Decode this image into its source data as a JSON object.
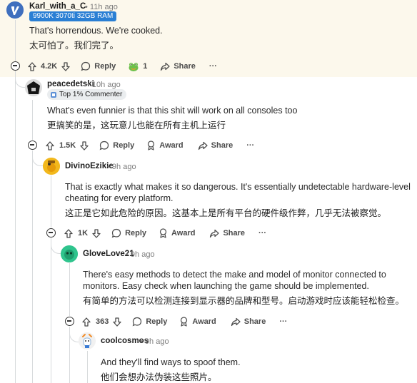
{
  "comments": [
    {
      "username": "Karl_with_a_C",
      "time": "11h ago",
      "flair": "9900K 3070ti 32GB RAM",
      "text": "That's horrendous. We're cooked.",
      "translation": "太可怕了。我们完了。",
      "votes": "4.2K",
      "reply_label": "Reply",
      "award_count": "1",
      "share_label": "Share",
      "more_label": "···"
    },
    {
      "username": "peacedetski",
      "time": "10h ago",
      "flair": "Top 1% Commenter",
      "text": "What's even funnier is that this shit will work on all consoles too",
      "translation": "更搞笑的是，这玩意儿也能在所有主机上运行",
      "votes": "1.5K",
      "reply_label": "Reply",
      "award_label": "Award",
      "share_label": "Share",
      "more_label": "···"
    },
    {
      "username": "DivinoEzikie",
      "time": "9h ago",
      "text": "That is exactly what makes it so dangerous. It's essentially undetectable hardware-level cheating for every platform.",
      "translation": "这正是它如此危险的原因。这基本上是所有平台的硬件级作弊，几乎无法被察觉。",
      "votes": "1K",
      "reply_label": "Reply",
      "award_label": "Award",
      "share_label": "Share",
      "more_label": "···"
    },
    {
      "username": "GloveLove21",
      "time": "9h ago",
      "text": "There's easy methods to detect the make and model of monitor connected to monitors. Easy check when launching the game should be implemented.",
      "translation": "有简单的方法可以检测连接到显示器的品牌和型号。启动游戏时应该能轻松检查。",
      "votes": "363",
      "reply_label": "Reply",
      "award_label": "Award",
      "share_label": "Share",
      "more_label": "···"
    },
    {
      "username": "coolcosmos",
      "time": "9h ago",
      "text": "And they'll find ways to spoof them.",
      "translation": "他们会想办法伪装这些照片。"
    }
  ],
  "colors": {
    "highlight_bg": "#fcf8ec",
    "flair_blue": "#2a7fd4",
    "thread_line": "#d7dadc",
    "meta_grey": "#7c7c7c"
  }
}
